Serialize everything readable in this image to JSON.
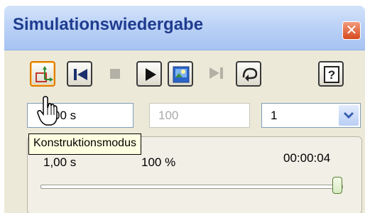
{
  "window": {
    "title": "Simulationswiedergabe"
  },
  "toolbar": {
    "buttons": [
      {
        "name": "construction-mode-button",
        "icon": "construction-mode-icon",
        "active": true
      },
      {
        "name": "rewind-to-start-button",
        "icon": "skip-back-icon"
      },
      {
        "name": "stop-button",
        "icon": "stop-icon",
        "disabled": true
      },
      {
        "name": "play-button",
        "icon": "play-icon"
      },
      {
        "name": "record-video-button",
        "icon": "video-icon"
      },
      {
        "name": "skip-to-end-button",
        "icon": "skip-forward-icon",
        "disabled": true
      },
      {
        "name": "loop-button",
        "icon": "loop-icon"
      },
      {
        "name": "help-button",
        "icon": "help-icon"
      }
    ]
  },
  "fields": {
    "time_value": "00 s",
    "steps_value": "100",
    "speed_value": "1"
  },
  "tooltip": {
    "text": "Konstruktionsmodus"
  },
  "playback": {
    "time_elapsed": "1,00 s",
    "percent": "100 %",
    "clock": "00:00:04",
    "progress_fraction": 1.0
  },
  "colors": {
    "title_text": "#1f3c8f",
    "titlebar": "#bcd2f7",
    "window_bg": "#ece9d8",
    "close_button": "#d6481e",
    "tooltip_bg": "#ffffe1",
    "active_border": "#e07a00"
  }
}
